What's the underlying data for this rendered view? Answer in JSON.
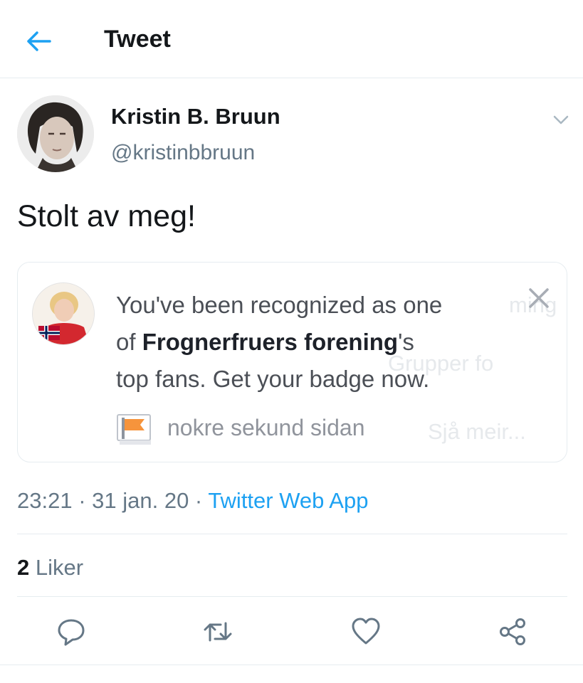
{
  "header": {
    "title": "Tweet",
    "back_icon": "arrow-left-icon"
  },
  "author": {
    "name": "Kristin B. Bruun",
    "handle": "@kristinbbruun"
  },
  "tweet": {
    "text": "Stolt av meg!"
  },
  "card": {
    "line1": "You've been recognized as one",
    "line2_prefix": "of ",
    "line2_bold": "Frognerfruers forening",
    "line2_suffix": "'s",
    "line3": "top fans. Get your badge now.",
    "time": "nokre sekund sidan",
    "background_text": [
      "ming",
      "Grupper fo",
      "Sjå meir..."
    ]
  },
  "meta": {
    "time": "23:21",
    "sep1": " · ",
    "date": "31 jan. 20",
    "sep2": " · ",
    "source": "Twitter Web App"
  },
  "stats": {
    "likes_count": "2",
    "likes_label": " Liker"
  },
  "actions": [
    "reply-icon",
    "retweet-icon",
    "like-icon",
    "share-icon"
  ],
  "colors": {
    "accent": "#1da1f2",
    "secondary_text": "#657786",
    "divider": "#e6ecf0"
  }
}
